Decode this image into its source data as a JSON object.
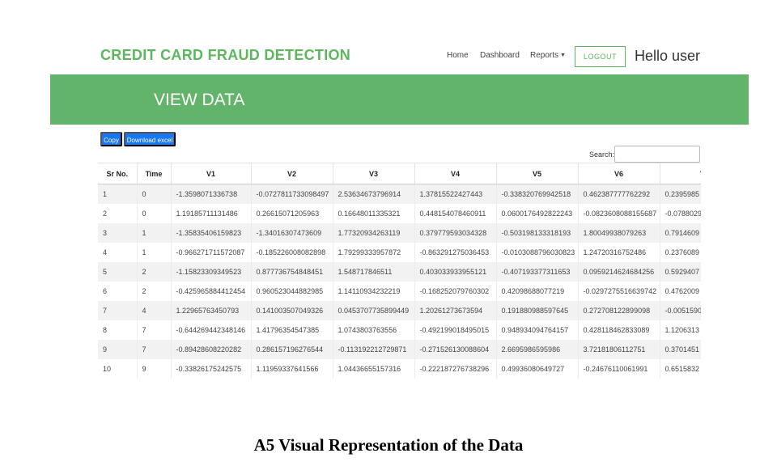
{
  "navbar": {
    "brand": "CREDIT CARD FRAUD DETECTION",
    "links": {
      "home": "Home",
      "dashboard": "Dashboard",
      "reports": "Reports"
    },
    "logout_label": "LOGOUT",
    "greeting": "Hello user"
  },
  "banner": {
    "title": "VIEW DATA",
    "color": "#63b46b"
  },
  "toolbar": {
    "copy_label": "Copy",
    "excel_label": "Download excel",
    "button_color": "#1877f2"
  },
  "search": {
    "label": "Search:"
  },
  "table": {
    "headers": [
      "Sr No.",
      "Time",
      "V1",
      "V2",
      "V3",
      "V4",
      "V5",
      "V6",
      "V"
    ],
    "rows": [
      [
        "1",
        "0",
        "-1.3598071336738",
        "-0.0727811733098497",
        "2.53634673796914",
        "1.37815522427443",
        "-0.338320769942518",
        "0.462387777762292",
        "0.2395985"
      ],
      [
        "2",
        "0",
        "1.19185711131486",
        "0.26615071205963",
        "0.16648011335321",
        "0.448154078460911",
        "0.0600176492822243",
        "-0.0823608088155687",
        "-0.0788029"
      ],
      [
        "3",
        "1",
        "-1.35835406159823",
        "-1.34016307473609",
        "1.77320934263119",
        "0.379779593034328",
        "-0.503198133318193",
        "1.80049938079263",
        "0.7914609"
      ],
      [
        "4",
        "1",
        "-0.966271711572087",
        "-0.185226008082898",
        "1.79299333957872",
        "-0.863291275036453",
        "-0.0103088796030823",
        "1.24720316752486",
        "0.2376089"
      ],
      [
        "5",
        "2",
        "-1.15823309349523",
        "0.877736754848451",
        "1.548717846511",
        "0.403033933955121",
        "-0.407193377311653",
        "0.0959214624684256",
        "0.5929407"
      ],
      [
        "6",
        "2",
        "-0.425965884412454",
        "0.960523044882985",
        "1.14110934232219",
        "-0.168252079760302",
        "0.42098688077219",
        "-0.0297275516639742",
        "0.4762009"
      ],
      [
        "7",
        "4",
        "1.22965763450793",
        "0.141003507049326",
        "0.0453707735899449",
        "1.20261273673594",
        "0.191880988597645",
        "0.272708122899098",
        "-0.0051590"
      ],
      [
        "8",
        "7",
        "-0.644269442348146",
        "1.41796354547385",
        "1.0743803763556",
        "-0.492199018495015",
        "0.948934094764157",
        "0.428118462833089",
        "1.1206313"
      ],
      [
        "9",
        "7",
        "-0.89428608220282",
        "0.286157196276544",
        "-0.113192212729871",
        "-0.271526130088604",
        "2.6695986595986",
        "3.72181806112751",
        "0.3701451"
      ],
      [
        "10",
        "9",
        "-0.33826175242575",
        "1.11959337641566",
        "1.04436655157316",
        "-0.222187276738296",
        "0.49936080649727",
        "-0.24676110061991",
        "0.6515832"
      ]
    ]
  },
  "caption": "A5 Visual Representation of the Data"
}
